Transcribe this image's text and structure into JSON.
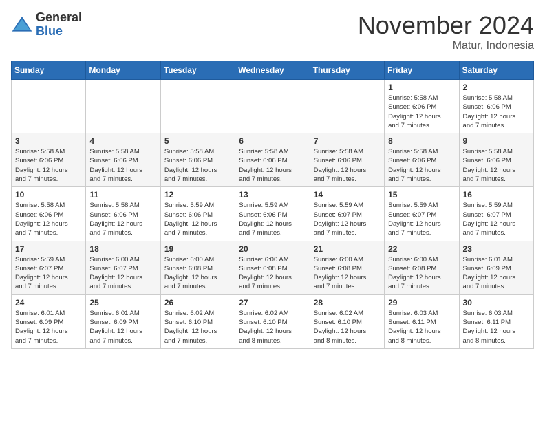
{
  "logo": {
    "general": "General",
    "blue": "Blue"
  },
  "title": "November 2024",
  "location": "Matur, Indonesia",
  "days_of_week": [
    "Sunday",
    "Monday",
    "Tuesday",
    "Wednesday",
    "Thursday",
    "Friday",
    "Saturday"
  ],
  "weeks": [
    [
      {
        "day": "",
        "info": ""
      },
      {
        "day": "",
        "info": ""
      },
      {
        "day": "",
        "info": ""
      },
      {
        "day": "",
        "info": ""
      },
      {
        "day": "",
        "info": ""
      },
      {
        "day": "1",
        "info": "Sunrise: 5:58 AM\nSunset: 6:06 PM\nDaylight: 12 hours\nand 7 minutes."
      },
      {
        "day": "2",
        "info": "Sunrise: 5:58 AM\nSunset: 6:06 PM\nDaylight: 12 hours\nand 7 minutes."
      }
    ],
    [
      {
        "day": "3",
        "info": "Sunrise: 5:58 AM\nSunset: 6:06 PM\nDaylight: 12 hours\nand 7 minutes."
      },
      {
        "day": "4",
        "info": "Sunrise: 5:58 AM\nSunset: 6:06 PM\nDaylight: 12 hours\nand 7 minutes."
      },
      {
        "day": "5",
        "info": "Sunrise: 5:58 AM\nSunset: 6:06 PM\nDaylight: 12 hours\nand 7 minutes."
      },
      {
        "day": "6",
        "info": "Sunrise: 5:58 AM\nSunset: 6:06 PM\nDaylight: 12 hours\nand 7 minutes."
      },
      {
        "day": "7",
        "info": "Sunrise: 5:58 AM\nSunset: 6:06 PM\nDaylight: 12 hours\nand 7 minutes."
      },
      {
        "day": "8",
        "info": "Sunrise: 5:58 AM\nSunset: 6:06 PM\nDaylight: 12 hours\nand 7 minutes."
      },
      {
        "day": "9",
        "info": "Sunrise: 5:58 AM\nSunset: 6:06 PM\nDaylight: 12 hours\nand 7 minutes."
      }
    ],
    [
      {
        "day": "10",
        "info": "Sunrise: 5:58 AM\nSunset: 6:06 PM\nDaylight: 12 hours\nand 7 minutes."
      },
      {
        "day": "11",
        "info": "Sunrise: 5:58 AM\nSunset: 6:06 PM\nDaylight: 12 hours\nand 7 minutes."
      },
      {
        "day": "12",
        "info": "Sunrise: 5:59 AM\nSunset: 6:06 PM\nDaylight: 12 hours\nand 7 minutes."
      },
      {
        "day": "13",
        "info": "Sunrise: 5:59 AM\nSunset: 6:06 PM\nDaylight: 12 hours\nand 7 minutes."
      },
      {
        "day": "14",
        "info": "Sunrise: 5:59 AM\nSunset: 6:07 PM\nDaylight: 12 hours\nand 7 minutes."
      },
      {
        "day": "15",
        "info": "Sunrise: 5:59 AM\nSunset: 6:07 PM\nDaylight: 12 hours\nand 7 minutes."
      },
      {
        "day": "16",
        "info": "Sunrise: 5:59 AM\nSunset: 6:07 PM\nDaylight: 12 hours\nand 7 minutes."
      }
    ],
    [
      {
        "day": "17",
        "info": "Sunrise: 5:59 AM\nSunset: 6:07 PM\nDaylight: 12 hours\nand 7 minutes."
      },
      {
        "day": "18",
        "info": "Sunrise: 6:00 AM\nSunset: 6:07 PM\nDaylight: 12 hours\nand 7 minutes."
      },
      {
        "day": "19",
        "info": "Sunrise: 6:00 AM\nSunset: 6:08 PM\nDaylight: 12 hours\nand 7 minutes."
      },
      {
        "day": "20",
        "info": "Sunrise: 6:00 AM\nSunset: 6:08 PM\nDaylight: 12 hours\nand 7 minutes."
      },
      {
        "day": "21",
        "info": "Sunrise: 6:00 AM\nSunset: 6:08 PM\nDaylight: 12 hours\nand 7 minutes."
      },
      {
        "day": "22",
        "info": "Sunrise: 6:00 AM\nSunset: 6:08 PM\nDaylight: 12 hours\nand 7 minutes."
      },
      {
        "day": "23",
        "info": "Sunrise: 6:01 AM\nSunset: 6:09 PM\nDaylight: 12 hours\nand 7 minutes."
      }
    ],
    [
      {
        "day": "24",
        "info": "Sunrise: 6:01 AM\nSunset: 6:09 PM\nDaylight: 12 hours\nand 7 minutes."
      },
      {
        "day": "25",
        "info": "Sunrise: 6:01 AM\nSunset: 6:09 PM\nDaylight: 12 hours\nand 7 minutes."
      },
      {
        "day": "26",
        "info": "Sunrise: 6:02 AM\nSunset: 6:10 PM\nDaylight: 12 hours\nand 7 minutes."
      },
      {
        "day": "27",
        "info": "Sunrise: 6:02 AM\nSunset: 6:10 PM\nDaylight: 12 hours\nand 8 minutes."
      },
      {
        "day": "28",
        "info": "Sunrise: 6:02 AM\nSunset: 6:10 PM\nDaylight: 12 hours\nand 8 minutes."
      },
      {
        "day": "29",
        "info": "Sunrise: 6:03 AM\nSunset: 6:11 PM\nDaylight: 12 hours\nand 8 minutes."
      },
      {
        "day": "30",
        "info": "Sunrise: 6:03 AM\nSunset: 6:11 PM\nDaylight: 12 hours\nand 8 minutes."
      }
    ]
  ]
}
